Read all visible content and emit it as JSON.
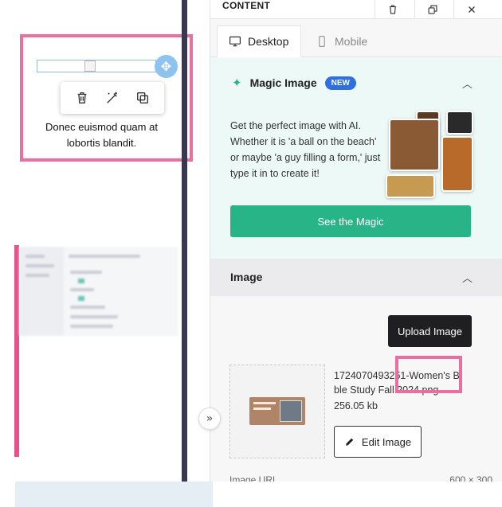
{
  "panel": {
    "header_title": "CONTENT",
    "tabs": [
      {
        "label": "Desktop",
        "icon": "desktop-icon",
        "active": true
      },
      {
        "label": "Mobile",
        "icon": "mobile-icon",
        "active": false
      }
    ]
  },
  "canvas": {
    "caption": "Donec euismod quam at lobortis blandit.",
    "toolbar_icons": [
      "trash-icon",
      "magic-edit-icon",
      "duplicate-icon"
    ],
    "move_icon": "move-icon"
  },
  "magic_image": {
    "title": "Magic Image",
    "badge": "NEW",
    "description": "Get the perfect image with AI. Whether it is 'a ball on the beach' or maybe 'a guy filling a form,' just type it in to create it!",
    "button_label": "See the Magic"
  },
  "image_section": {
    "title": "Image",
    "upload_label": "Upload Image",
    "file_name": "1724070493251-Women's Bible Study Fall 2024.png",
    "file_size": "256.05 kb",
    "edit_label": "Edit Image",
    "url_label": "Image URL",
    "dimensions": "600 × 300"
  },
  "colors": {
    "accent_green": "#28b486",
    "badge_blue": "#2f6fe0",
    "highlight_pink": "#e86fa0",
    "magic_bg": "#ecf9f6"
  }
}
